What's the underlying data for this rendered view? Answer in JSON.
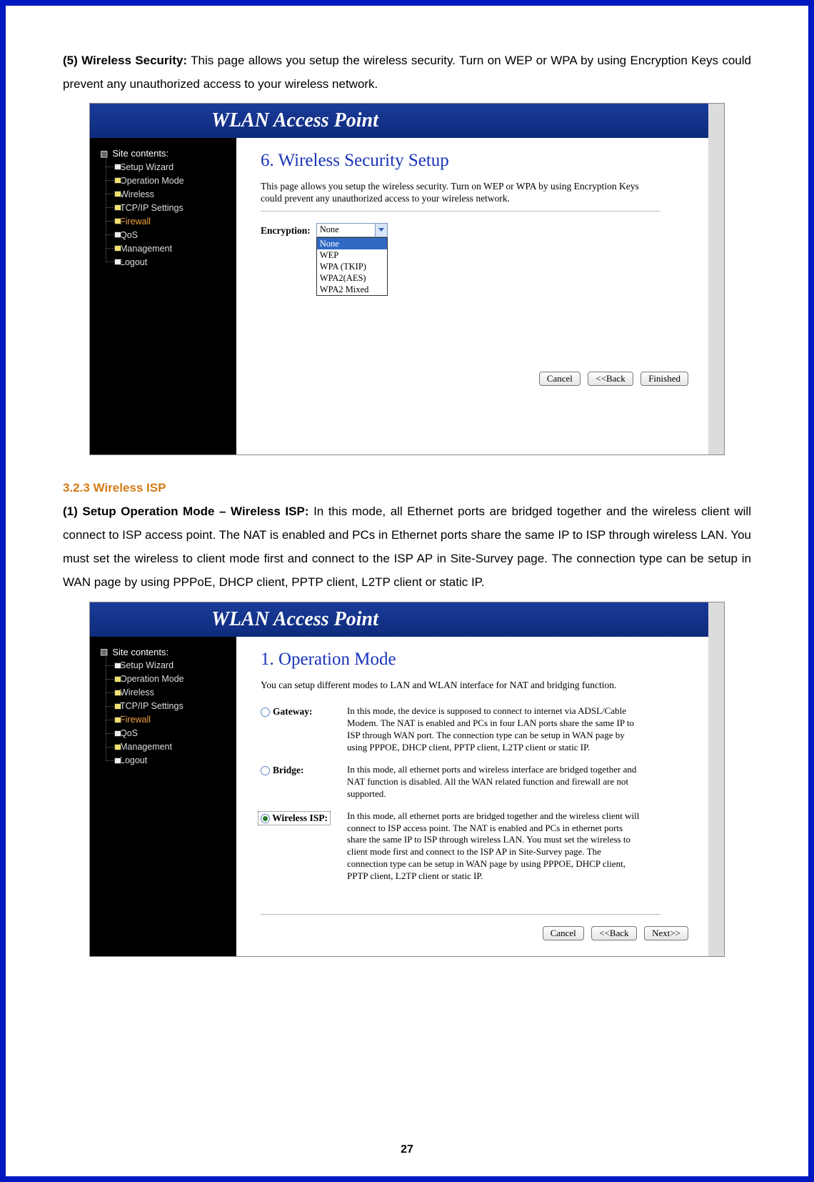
{
  "intro1": {
    "bold_prefix": "(5) Wireless Security:",
    "rest": " This page allows you setup the wireless security. Turn on WEP or WPA by using Encryption Keys could prevent any unauthorized access to your wireless network."
  },
  "section_heading": "3.2.3 Wireless ISP",
  "intro2": {
    "bold_prefix": "(1) Setup Operation Mode – Wireless ISP:",
    "rest": " In this mode, all Ethernet ports are bridged together and the wireless client will connect to ISP access point. The NAT is enabled and PCs in Ethernet ports share the same IP to ISP through wireless LAN. You must set the wireless to client mode first and connect to the ISP AP in Site-Survey page. The connection type can be setup in WAN page by using PPPoE, DHCP client, PPTP client, L2TP client or static IP."
  },
  "page_number": "27",
  "banner_title": "WLAN Access Point",
  "sidebar": {
    "root": "Site contents:",
    "items": [
      {
        "label": "Setup Wizard",
        "variant": "white"
      },
      {
        "label": "Operation Mode",
        "variant": "yellow"
      },
      {
        "label": "Wireless",
        "variant": "yellow"
      },
      {
        "label": "TCP/IP Settings",
        "variant": "yellow"
      },
      {
        "label": "Firewall",
        "variant": "yellow",
        "active": true
      },
      {
        "label": "QoS",
        "variant": "white"
      },
      {
        "label": "Management",
        "variant": "yellow"
      },
      {
        "label": "Logout",
        "variant": "white"
      }
    ]
  },
  "shot1": {
    "title": "6. Wireless Security Setup",
    "desc": "This page allows you setup the wireless security. Turn on WEP or WPA by using Encryption Keys could prevent any unauthorized access to your wireless network.",
    "enc_label": "Encryption:",
    "dd_value": "None",
    "dd_options": [
      "None",
      "WEP",
      "WPA (TKIP)",
      "WPA2(AES)",
      "WPA2 Mixed"
    ],
    "buttons": {
      "cancel": "Cancel",
      "back": "<<Back",
      "finish": "Finished"
    }
  },
  "shot2": {
    "title": "1. Operation Mode",
    "desc": "You can setup different modes to LAN and WLAN interface for NAT and bridging function.",
    "modes": [
      {
        "name": "Gateway:",
        "selected": false,
        "desc": "In this mode, the device is supposed to connect to internet via ADSL/Cable Modem. The NAT is enabled and PCs in four LAN ports share the same IP to ISP through WAN port. The connection type can be setup in WAN page by using PPPOE, DHCP client, PPTP client, L2TP client or static IP."
      },
      {
        "name": "Bridge:",
        "selected": false,
        "desc": "In this mode, all ethernet ports and wireless interface are bridged together and NAT function is disabled. All the WAN related function and firewall are not supported."
      },
      {
        "name": "Wireless ISP:",
        "selected": true,
        "desc": "In this mode, all ethernet ports are bridged together and the wireless client will connect to ISP access point. The NAT is enabled and PCs in ethernet ports share the same IP to ISP through wireless LAN. You must set the wireless to client mode first and connect to the ISP AP in Site-Survey page. The connection type can be setup in WAN page by using PPPOE, DHCP client, PPTP client, L2TP client or static IP."
      }
    ],
    "buttons": {
      "cancel": "Cancel",
      "back": "<<Back",
      "next": "Next>>"
    }
  }
}
